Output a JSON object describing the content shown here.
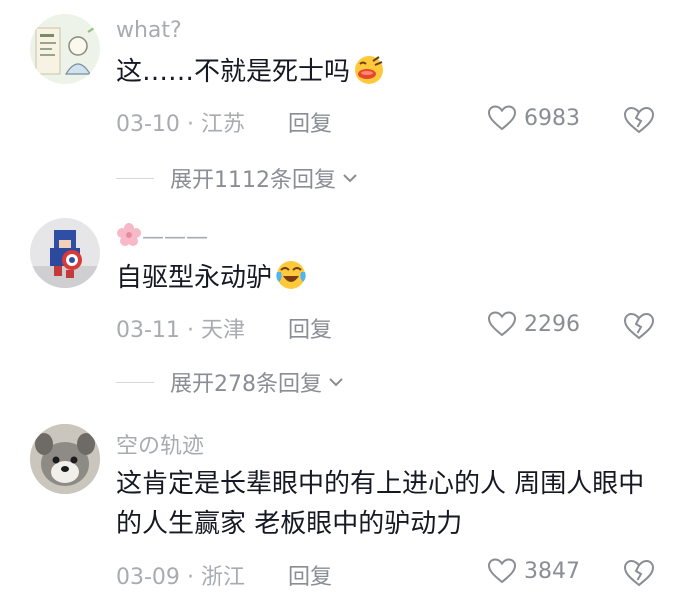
{
  "comments": [
    {
      "username": "what?",
      "text": "这……不就是死士吗",
      "date": "03-10",
      "location": "江苏",
      "reply_label": "回复",
      "likes": "6983",
      "expand_label": "展开1112条回复"
    },
    {
      "username": "———",
      "text": "自驱型永动驴",
      "date": "03-11",
      "location": "天津",
      "reply_label": "回复",
      "likes": "2296",
      "expand_label": "展开278条回复"
    },
    {
      "username": "空の轨迹",
      "text": "这肯定是长辈眼中的有上进心的人 周围人眼中的人生赢家 老板眼中的驴动力",
      "date": "03-09",
      "location": "浙江",
      "reply_label": "回复",
      "likes": "3847"
    }
  ],
  "separator": "·",
  "icons": {
    "like": "heart-outline-icon",
    "dislike": "broken-heart-icon",
    "expand": "chevron-down-icon"
  }
}
